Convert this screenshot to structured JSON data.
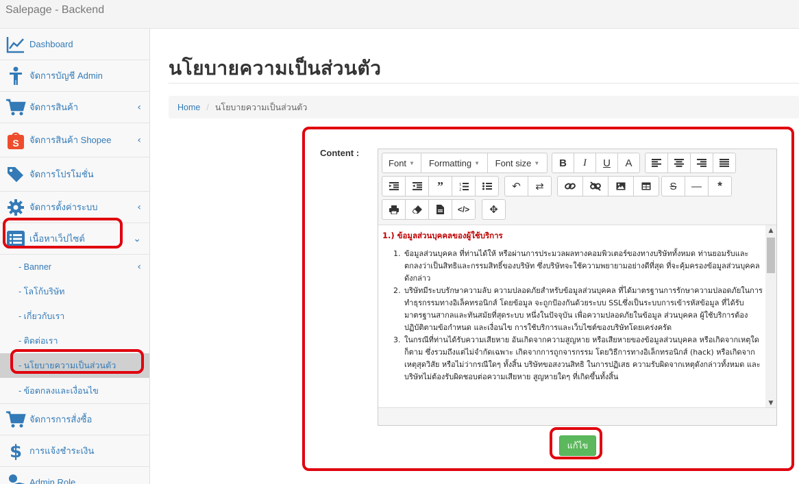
{
  "app": {
    "title": "Salepage - Backend"
  },
  "sidebar": {
    "items": [
      {
        "label": "Dashboard",
        "icon": "chart-line-icon"
      },
      {
        "label": "จัดการบัญชี Admin",
        "icon": "user-icon"
      },
      {
        "label": "จัดการสินค้า",
        "icon": "cart-icon",
        "caret": "‹"
      },
      {
        "label": "จัดการสินค้า Shopee",
        "icon": "shopee-icon",
        "caret": "‹"
      },
      {
        "label": "จัดการโปรโมชั่น",
        "icon": "tags-icon"
      },
      {
        "label": "จัดการตั้งค่าระบบ",
        "icon": "gear-icon",
        "caret": "‹"
      },
      {
        "label": "เนื้อหาเว็ปไซต์",
        "icon": "list-icon",
        "caret": "⌄"
      }
    ],
    "subitems": [
      {
        "label": "- Banner",
        "caret": "‹"
      },
      {
        "label": "- โลโก้บริษัท"
      },
      {
        "label": "- เกี่ยวกับเรา"
      },
      {
        "label": "- ติดต่อเรา"
      },
      {
        "label": "- นโยบายความเป็นส่วนตัว"
      },
      {
        "label": "- ข้อตกลงและเงื่อนไข"
      }
    ],
    "bottom_items": [
      {
        "label": "จัดการการสั่งซื้อ",
        "icon": "cart-icon"
      },
      {
        "label": "การแจ้งชำระเงิน",
        "icon": "dollar-icon"
      },
      {
        "label": "Admin Role",
        "icon": "user-shield-icon"
      }
    ]
  },
  "page": {
    "title": "นโยบายความเป็นส่วนตัว",
    "breadcrumb": {
      "home": "Home",
      "separator": "/",
      "current": "นโยบายความเป็นส่วนตัว"
    }
  },
  "form": {
    "content_label": "Content :",
    "save_label": "แก้ไข"
  },
  "editor": {
    "toolbar": {
      "font": "Font",
      "formatting": "Formatting",
      "font_size": "Font size"
    },
    "heading": "1.) ข้อมูลส่วนบุคคลของผู้ใช้บริการ",
    "items": [
      "ข้อมูลส่วนบุคคล ที่ท่านได้ให้ หรือผ่านการประมวลผลทางคอมพิวเตอร์ของทางบริษัททั้งหมด ท่านยอมรับและตกลงว่าเป็นสิทธิและกรรมสิทธิ์ของบริษัท ซึ่งบริษัทจะใช้ความพยายามอย่างดีที่สุด ที่จะคุ้มครองข้อมูลส่วนบุคคลดังกล่าว",
      "บริษัทมีระบบรักษาความลับ ความปลอดภัยสำหรับข้อมูลส่วนบุคคล ที่ได้มาตรฐานการรักษาความปลอดภัยในการทำธุรกรรมทางอิเล็คทรอนิกส์ โดยข้อมูล จะถูกป้องกันด้วยระบบ SSLซึ่งเป็นระบบการเข้ารหัสข้อมูล ที่ได้รับมาตรฐานสากลและทันสมัยที่สุดระบบ หนึ่งในปัจจุบัน เพื่อความปลอดภัยในข้อมูล ส่วนบุคคล ผู้ใช้บริการต้องปฏิบัติตามข้อกำหนด และเงื่อนไข การใช้บริการและเว็บไซต์ของบริษัทโดยเคร่งครัด",
      "ในกรณีที่ท่านได้รับความเสียหาย อันเกิดจากความสูญหาย หรือเสียหายของข้อมูลส่วนบุคคล หรือเกิดจากเหตุใดก็ตาม ซึ่งรวมถึงแต่ไม่จำกัดเฉพาะ เกิดจากการถูกจารกรรม โดยวิธีการทางอิเล็กทรอนิกส์ (hack) หรือเกิดจากเหตุสุดวิสัย หรือไม่ว่ากรณีใดๆ ทั้งสิ้น บริษัทขอสงวนสิทธิ ในการปฏิเสธ ความรับผิดจากเหตุดังกล่าวทั้งหมด และบริษัทไม่ต้องรับผิดชอบต่อความเสียหาย สูญหายใดๆ ที่เกิดขึ้นทั้งสิ้น"
    ]
  },
  "colors": {
    "link": "#337ab7",
    "highlight": "#e0000e",
    "save": "#5cb85c",
    "heading_red": "#c00000"
  }
}
